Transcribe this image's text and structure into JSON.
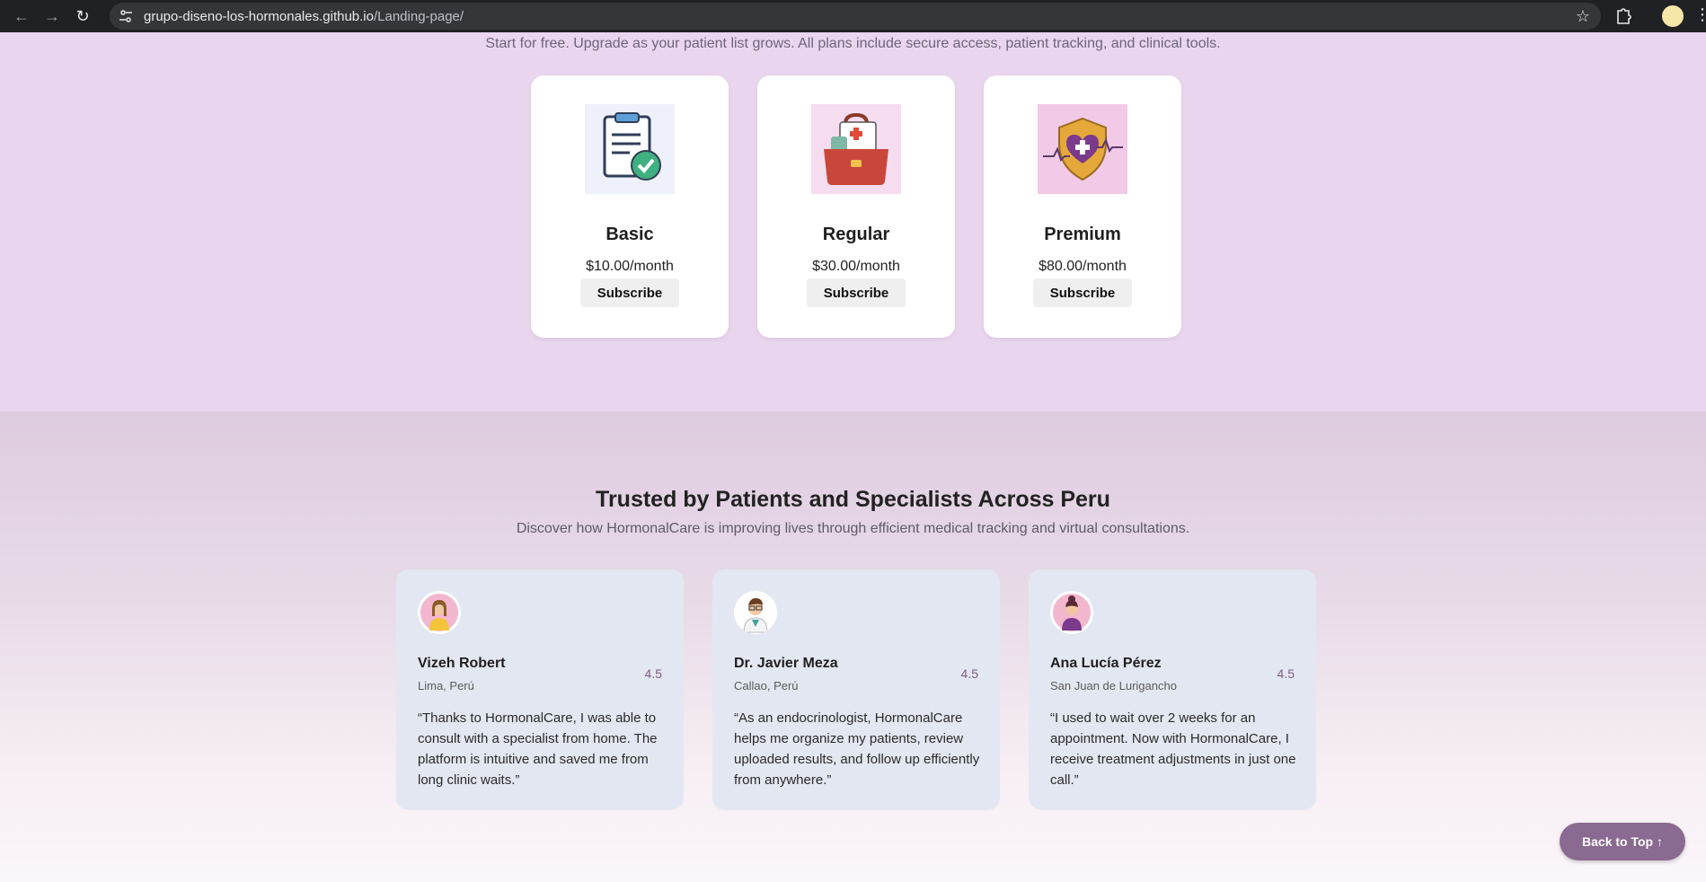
{
  "browser": {
    "url_host": "grupo-diseno-los-hormonales.github.io",
    "url_path": "/Landing-page/",
    "back_icon": "arrow-left-icon",
    "forward_icon": "arrow-right-icon",
    "reload_icon": "reload-icon",
    "bookmark_icon": "star-icon"
  },
  "pricing": {
    "subtitle": "Start for free. Upgrade as your patient list grows. All plans include secure access, patient tracking, and clinical tools.",
    "plans": [
      {
        "name": "Basic",
        "price": "$10.00/month",
        "button": "Subscribe",
        "icon": "clipboard-check-icon"
      },
      {
        "name": "Regular",
        "price": "$30.00/month",
        "button": "Subscribe",
        "icon": "medical-bag-icon"
      },
      {
        "name": "Premium",
        "price": "$80.00/month",
        "button": "Subscribe",
        "icon": "heart-shield-icon"
      }
    ]
  },
  "testimonials": {
    "title": "Trusted by Patients and Specialists Across Peru",
    "subtitle": "Discover how HormonalCare is improving lives through efficient medical tracking and virtual consultations.",
    "items": [
      {
        "name": "Vizeh Robert",
        "location": "Lima, Perú",
        "rating": "4.5",
        "quote": "“Thanks to HormonalCare, I was able to consult with a specialist from home. The platform is intuitive and saved me from long clinic waits.”"
      },
      {
        "name": "Dr. Javier Meza",
        "location": "Callao, Perú",
        "rating": "4.5",
        "quote": "“As an endocrinologist, HormonalCare helps me organize my patients, review uploaded results, and follow up efficiently from anywhere.”"
      },
      {
        "name": "Ana Lucía Pérez",
        "location": "San Juan de Lurigancho",
        "rating": "4.5",
        "quote": "“I used to wait over 2 weeks for an appointment. Now with HormonalCare, I receive treatment adjustments in just one call.”"
      }
    ]
  },
  "back_to_top": {
    "label": "Back to Top ↑"
  },
  "colors": {
    "accent": "#8a6a90",
    "pricing_bg": "#ead5ef",
    "card_bg": "#e3e7f1"
  }
}
